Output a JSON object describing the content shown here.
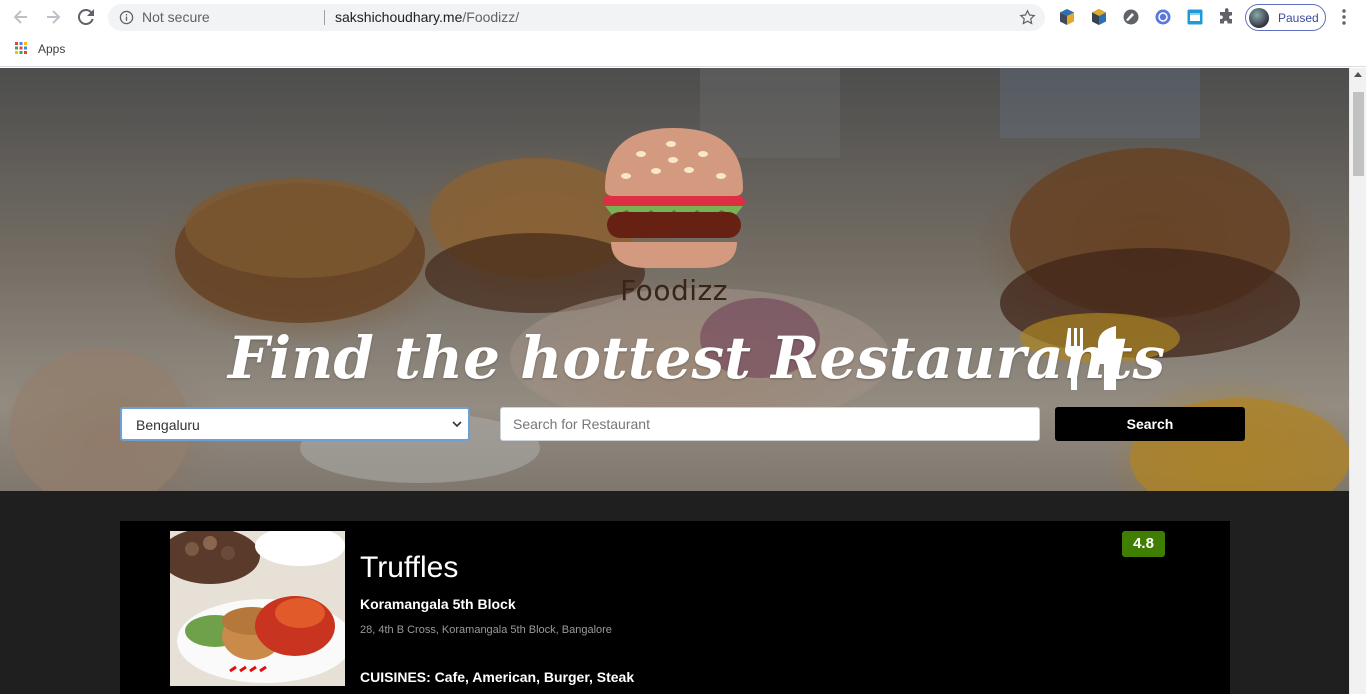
{
  "browser": {
    "security_label": "Not secure",
    "url_host": "sakshichoudhary.me",
    "url_path": "/Foodizz/",
    "profile_label": "Paused",
    "bookmarks": [
      {
        "label": "Apps"
      }
    ]
  },
  "hero": {
    "brand": "Foodizz",
    "tagline": "Find the hottest Restaurants",
    "city_select": {
      "value": "Bengaluru"
    },
    "search": {
      "placeholder": "Search for Restaurant",
      "button_label": "Search"
    }
  },
  "restaurants": [
    {
      "name": "Truffles",
      "area": "Koramangala 5th Block",
      "address": "28, 4th B Cross, Koramangala 5th Block, Bangalore",
      "cuisines": "CUISINES: Cafe, American, Burger, Steak",
      "rating": "4.8"
    }
  ],
  "colors": {
    "rating_badge": "#3f7e00",
    "search_button": "#000000",
    "page_background": "#1f1f1f"
  }
}
